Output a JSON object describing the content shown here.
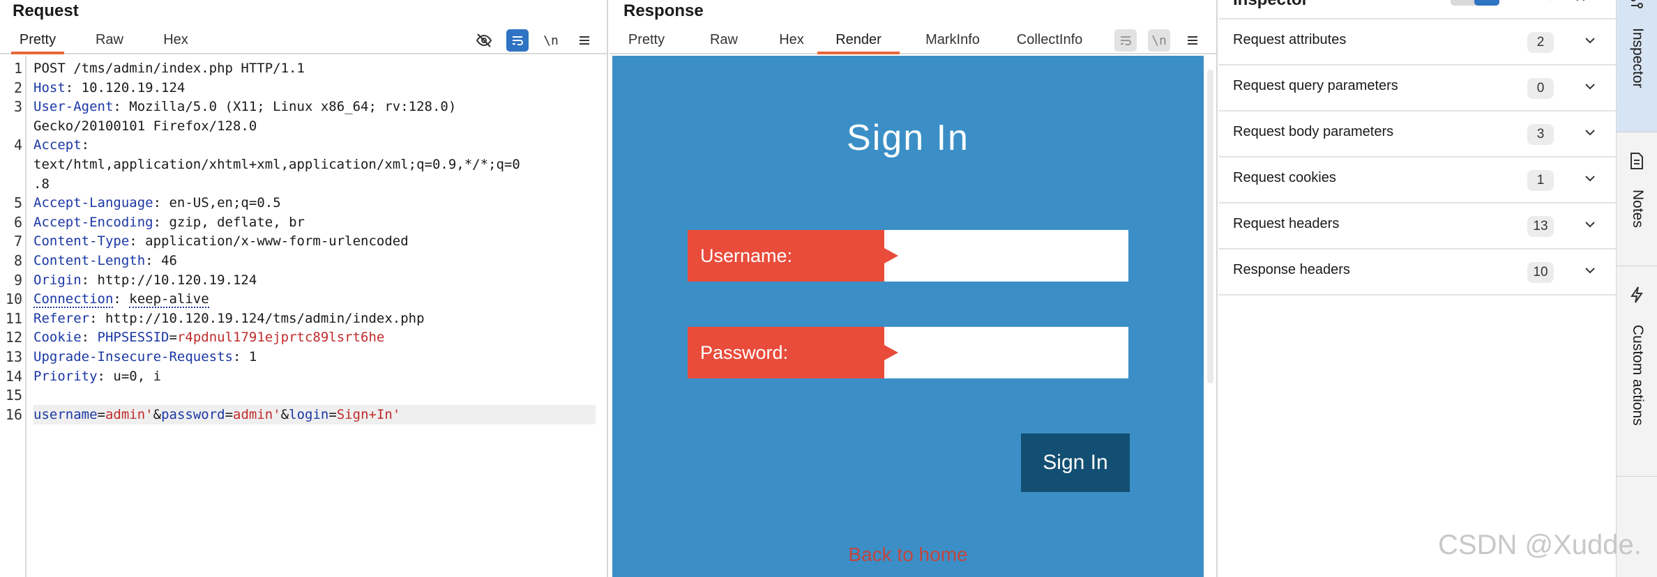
{
  "request": {
    "title": "Request",
    "tabs": [
      "Pretty",
      "Raw",
      "Hex"
    ],
    "active_tab": "Pretty",
    "tools": [
      "eye-off-icon",
      "wrap-icon",
      "newline-toggle",
      "menu-icon"
    ],
    "newline_label": "\\n",
    "lines": [
      {
        "n": "1",
        "parts": [
          [
            "hval",
            "POST /tms/admin/index.php HTTP/1.1"
          ]
        ]
      },
      {
        "n": "2",
        "parts": [
          [
            "hname",
            "Host"
          ],
          [
            "hsep",
            ": "
          ],
          [
            "hval",
            "10.120.19.124"
          ]
        ]
      },
      {
        "n": "3",
        "parts": [
          [
            "hname",
            "User-Agent"
          ],
          [
            "hsep",
            ": "
          ],
          [
            "hval",
            "Mozilla/5.0 (X11; Linux x86_64; rv:128.0)"
          ]
        ]
      },
      {
        "n": "",
        "parts": [
          [
            "hval",
            "Gecko/20100101 Firefox/128.0"
          ]
        ]
      },
      {
        "n": "4",
        "parts": [
          [
            "hname",
            "Accept"
          ],
          [
            "hsep",
            ":"
          ]
        ]
      },
      {
        "n": "",
        "parts": [
          [
            "hval",
            "text/html,application/xhtml+xml,application/xml;q=0.9,*/*;q=0"
          ]
        ]
      },
      {
        "n": "",
        "parts": [
          [
            "hval",
            ".8"
          ]
        ]
      },
      {
        "n": "5",
        "parts": [
          [
            "hname",
            "Accept-Language"
          ],
          [
            "hsep",
            ": "
          ],
          [
            "hval",
            "en-US,en;q=0.5"
          ]
        ]
      },
      {
        "n": "6",
        "parts": [
          [
            "hname",
            "Accept-Encoding"
          ],
          [
            "hsep",
            ": "
          ],
          [
            "hval",
            "gzip, deflate, br"
          ]
        ]
      },
      {
        "n": "7",
        "parts": [
          [
            "hname",
            "Content-Type"
          ],
          [
            "hsep",
            ": "
          ],
          [
            "hval",
            "application/x-www-form-urlencoded"
          ]
        ]
      },
      {
        "n": "8",
        "parts": [
          [
            "hname",
            "Content-Length"
          ],
          [
            "hsep",
            ": "
          ],
          [
            "hval",
            "46"
          ]
        ]
      },
      {
        "n": "9",
        "parts": [
          [
            "hname",
            "Origin"
          ],
          [
            "hsep",
            ": "
          ],
          [
            "hval",
            "http://10.120.19.124"
          ]
        ]
      },
      {
        "n": "10",
        "parts": [
          [
            "hname dotted",
            "Connection"
          ],
          [
            "hsep",
            ": "
          ],
          [
            "hval dotted",
            "keep-alive"
          ]
        ]
      },
      {
        "n": "11",
        "parts": [
          [
            "hname",
            "Referer"
          ],
          [
            "hsep",
            ": "
          ],
          [
            "hval",
            "http://10.120.19.124/tms/admin/index.php"
          ]
        ]
      },
      {
        "n": "12",
        "parts": [
          [
            "hname",
            "Cookie"
          ],
          [
            "hsep",
            ": "
          ],
          [
            "pname",
            "PHPSESSID"
          ],
          [
            "pop",
            "="
          ],
          [
            "pval",
            "r4pdnul1791ejprtc89lsrt6he"
          ]
        ]
      },
      {
        "n": "13",
        "parts": [
          [
            "hname",
            "Upgrade-Insecure-Requests"
          ],
          [
            "hsep",
            ": "
          ],
          [
            "hval",
            "1"
          ]
        ]
      },
      {
        "n": "14",
        "parts": [
          [
            "hname",
            "Priority"
          ],
          [
            "hsep",
            ": "
          ],
          [
            "hval",
            "u=0, i"
          ]
        ]
      },
      {
        "n": "15",
        "parts": []
      },
      {
        "n": "16",
        "highlight": true,
        "parts": [
          [
            "pname",
            "username"
          ],
          [
            "pop",
            "="
          ],
          [
            "pval",
            "admin'"
          ],
          [
            "pop",
            "&"
          ],
          [
            "pname",
            "password"
          ],
          [
            "pop",
            "="
          ],
          [
            "pval",
            "admin'"
          ],
          [
            "pop",
            "&"
          ],
          [
            "pname",
            "login"
          ],
          [
            "pop",
            "="
          ],
          [
            "pval",
            "Sign+In'"
          ]
        ]
      }
    ]
  },
  "response": {
    "title": "Response",
    "tabs": [
      "Pretty",
      "Raw",
      "Hex",
      "Render",
      "MarkInfo",
      "CollectInfo"
    ],
    "active_tab": "Render",
    "newline_label": "\\n",
    "render": {
      "heading": "Sign In",
      "username_label": "Username:",
      "password_label": "Password:",
      "button_label": "Sign In",
      "back_link": "Back to home",
      "colors": {
        "background": "#3b8fc6",
        "label": "#e94c3b",
        "button": "#124f72"
      }
    }
  },
  "inspector": {
    "title": "Inspector",
    "rows": [
      {
        "label": "Request attributes",
        "count": "2"
      },
      {
        "label": "Request query parameters",
        "count": "0"
      },
      {
        "label": "Request body parameters",
        "count": "3"
      },
      {
        "label": "Request cookies",
        "count": "1"
      },
      {
        "label": "Request headers",
        "count": "13"
      },
      {
        "label": "Response headers",
        "count": "10"
      }
    ]
  },
  "side_tabs": {
    "inspector": "Inspector",
    "notes": "Notes",
    "custom_actions": "Custom actions"
  },
  "watermark": "CSDN @Xudde."
}
